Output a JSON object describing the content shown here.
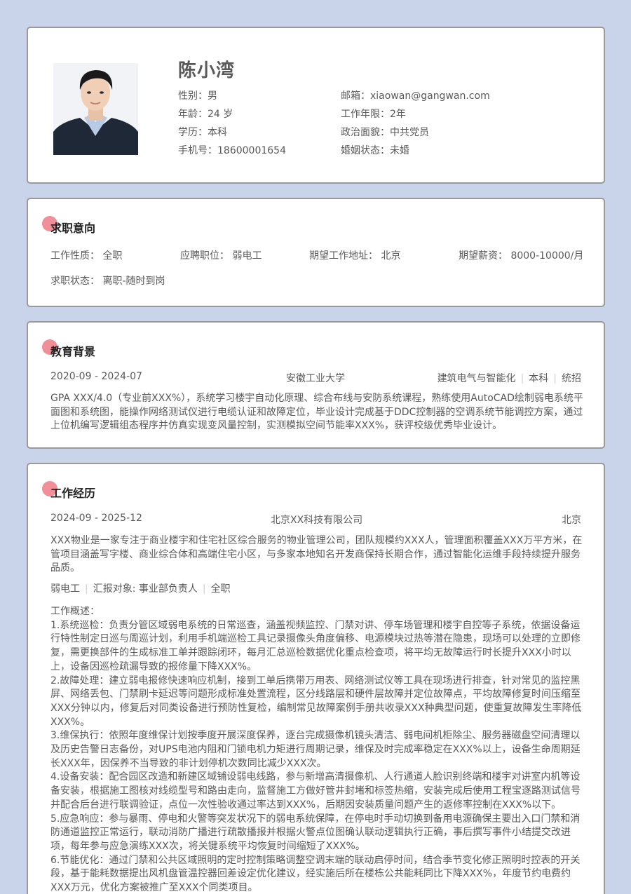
{
  "profile": {
    "name": "陈小湾",
    "gender_label": "性别：",
    "gender": "男",
    "age_label": "年龄：",
    "age": "24 岁",
    "education_label": "学历：",
    "education": "本科",
    "phone_label": "手机号：",
    "phone": "18600001654",
    "email_label": "邮箱：",
    "email": "xiaowan@gangwan.com",
    "years_label": "工作年限：",
    "years": "2年",
    "political_label": "政治面貌：",
    "political": "中共党员",
    "marital_label": "婚姻状态：",
    "marital": "未婚"
  },
  "intent": {
    "title": "求职意向",
    "type_label": "工作性质：",
    "type": "全职",
    "position_label": "应聘职位：",
    "position": "弱电工",
    "location_label": "期望工作地址：",
    "location": "北京",
    "salary_label": "期望薪资：",
    "salary": "8000-10000/月",
    "status_label": "求职状态：",
    "status": "离职-随时到岗"
  },
  "education": {
    "title": "教育背景",
    "period": "2020-09 - 2024-07",
    "school": "安徽工业大学",
    "major": "建筑电气与智能化",
    "degree": "本科",
    "enroll": "统招",
    "description": "GPA XXX/4.0（专业前XXX%），系统学习楼宇自动化原理、综合布线与安防系统课程，熟练使用AutoCAD绘制弱电系统平面图和系统图，能操作网络测试仪进行电缆认证和故障定位，毕业设计完成基于DDC控制器的空调系统节能调控方案，通过上位机编写逻辑组态程序并仿真实现变风量控制，实测模拟空间节能率XXX%，获评校级优秀毕业设计。"
  },
  "work": {
    "title": "工作经历",
    "period": "2024-09 - 2025-12",
    "company": "北京XX科技有限公司",
    "city": "北京",
    "company_desc": "XXX物业是一家专注于商业楼宇和住宅社区综合服务的物业管理公司，团队规模约XXX人，管理面积覆盖XXX万平方米，在管项目涵盖写字楼、商业综合体和高端住宅小区，与多家本地知名开发商保持长期合作，通过智能化运维手段持续提升服务品质。",
    "role": "弱电工",
    "report": "汇报对象: 事业部负责人",
    "employment": "全职",
    "overview_label": "工作概述：",
    "items": [
      "1.系统巡检：负责分管区域弱电系统的日常巡查，涵盖视频监控、门禁对讲、停车场管理和楼宇自控等子系统，依据设备运行特性制定日巡与周巡计划，利用手机端巡检工具记录摄像头角度偏移、电源模块过热等潜在隐患，现场可以处理的立即修复，需更换部件的生成标准工单并跟踪闭环，每月汇总巡检数据优化重点检查项，将平均无故障运行时长提升XXX小时以上，设备因巡检疏漏导致的报修量下降XXX%。",
      "2.故障处理：建立弱电报修快速响应机制，接到工单后携带万用表、网络测试仪等工具在现场进行排查，针对常见的监控黑屏、网络丢包、门禁刷卡延迟等问题形成标准处置流程，区分线路层和硬件层故障并定位故障点，平均故障修复时间压缩至XXX分钟以内，修复后对同类设备进行预防性复检，编制常见故障案例手册共收录XXX种典型问题，使重复故障发生率降低XXX%。",
      "3.维保执行：依照年度维保计划按季度开展深度保养，逐台完成摄像机镜头清洁、弱电间机柜除尘、服务器磁盘空间清理以及历史告警日志备份，对UPS电池内阻和门锁电机力矩进行周期记录，维保及时完成率稳定在XXX%以上，设备生命周期延长XXX年，因保养不当导致的非计划停机次数同比减少XXX次。",
      "4.设备安装：配合园区改造和新建区域铺设弱电线路，参与新增高清摄像机、人行通道人脸识别终端和楼宇对讲室内机等设备安装，根据施工图核对线缆型号和路由走向，监督施工方做好管井封堵和标签热缩，安装完成后使用工程宝逐路测试信号并配合后台进行联调验证，点位一次性验收通过率达到XXX%，后期因安装质量问题产生的返修率控制在XXX%以下。",
      "5.应急响应：参与暴雨、停电和火警等突发状况下的弱电系统保障，在停电时手动切换到备用电源确保主要出入口门禁和消防通道监控正常运行，联动消防广播进行疏散播报并根据火警点位图确认联动逻辑执行正确，事后撰写事件小结提交改进项，每年参与应急演练XXX次，将关键系统平均恢复时间缩短了XXX%。",
      "6.节能优化：通过门禁和公共区域照明的定时控制策略调整空调末端的联动启停时间，结合季节变化修正照明时控表的开关段，基于能耗数据提出风机盘管温控器回差设定优化建议，经实施后所在楼栋公共能耗同比下降XXX%，年度节约电费约XXX万元，优化方案被推广至XXX个同类项目。"
    ]
  },
  "colors": {
    "background": "#c9d4ea",
    "card_border": "#9a9a9a",
    "accent_dot": "#f08f97",
    "text": "#595959"
  }
}
